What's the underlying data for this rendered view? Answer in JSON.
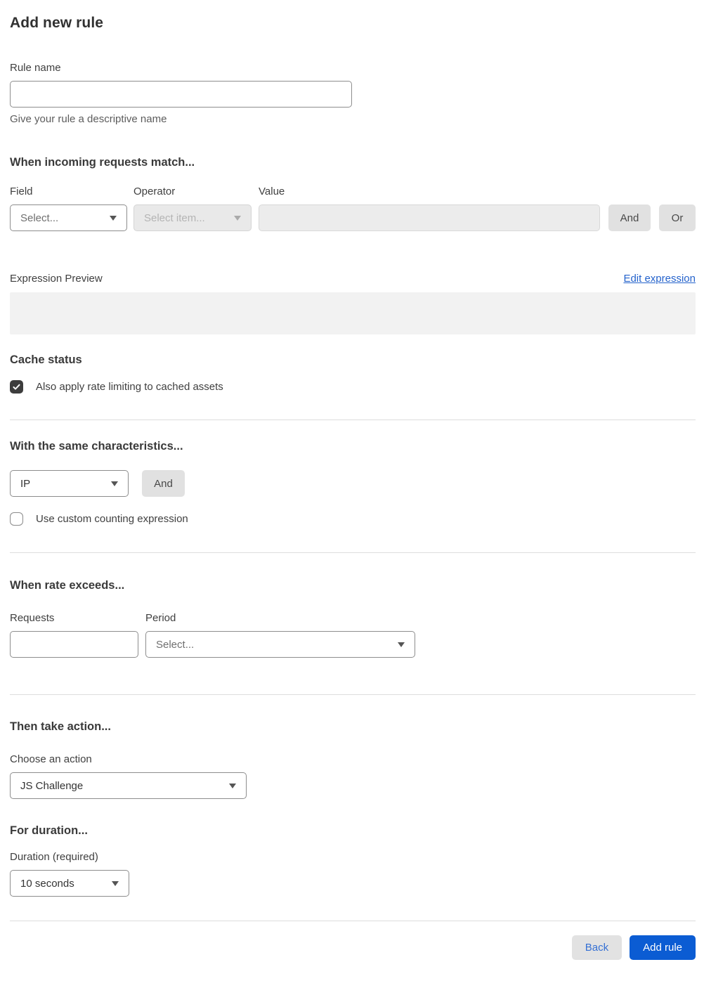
{
  "page": {
    "title": "Add new rule"
  },
  "rule_name": {
    "label": "Rule name",
    "value": "",
    "helper": "Give your rule a descriptive name"
  },
  "match": {
    "heading": "When incoming requests match...",
    "field_label": "Field",
    "field_value": "Select...",
    "operator_label": "Operator",
    "operator_value": "Select item...",
    "value_label": "Value",
    "value_text": "",
    "and_label": "And",
    "or_label": "Or"
  },
  "expression": {
    "label": "Expression Preview",
    "edit_link": "Edit expression",
    "preview": ""
  },
  "cache": {
    "heading": "Cache status",
    "checkbox_label": "Also apply rate limiting to cached assets",
    "checked": true
  },
  "characteristics": {
    "heading": "With the same characteristics...",
    "select_value": "IP",
    "and_label": "And",
    "checkbox_label": "Use custom counting expression",
    "checked": false
  },
  "rate": {
    "heading": "When rate exceeds...",
    "requests_label": "Requests",
    "requests_value": "",
    "period_label": "Period",
    "period_value": "Select..."
  },
  "action": {
    "heading": "Then take action...",
    "label": "Choose an action",
    "value": "JS Challenge"
  },
  "duration": {
    "heading": "For duration...",
    "label": "Duration (required)",
    "value": "10 seconds"
  },
  "footer": {
    "back_label": "Back",
    "submit_label": "Add rule"
  },
  "colors": {
    "primary_blue": "#0b5cd3",
    "link_blue": "#2563cc",
    "checkbox_dark": "#3d3d3d",
    "disabled_bg": "#e9e9e9",
    "preview_bg": "#f2f2f2",
    "button_gray": "#e1e1e1"
  }
}
